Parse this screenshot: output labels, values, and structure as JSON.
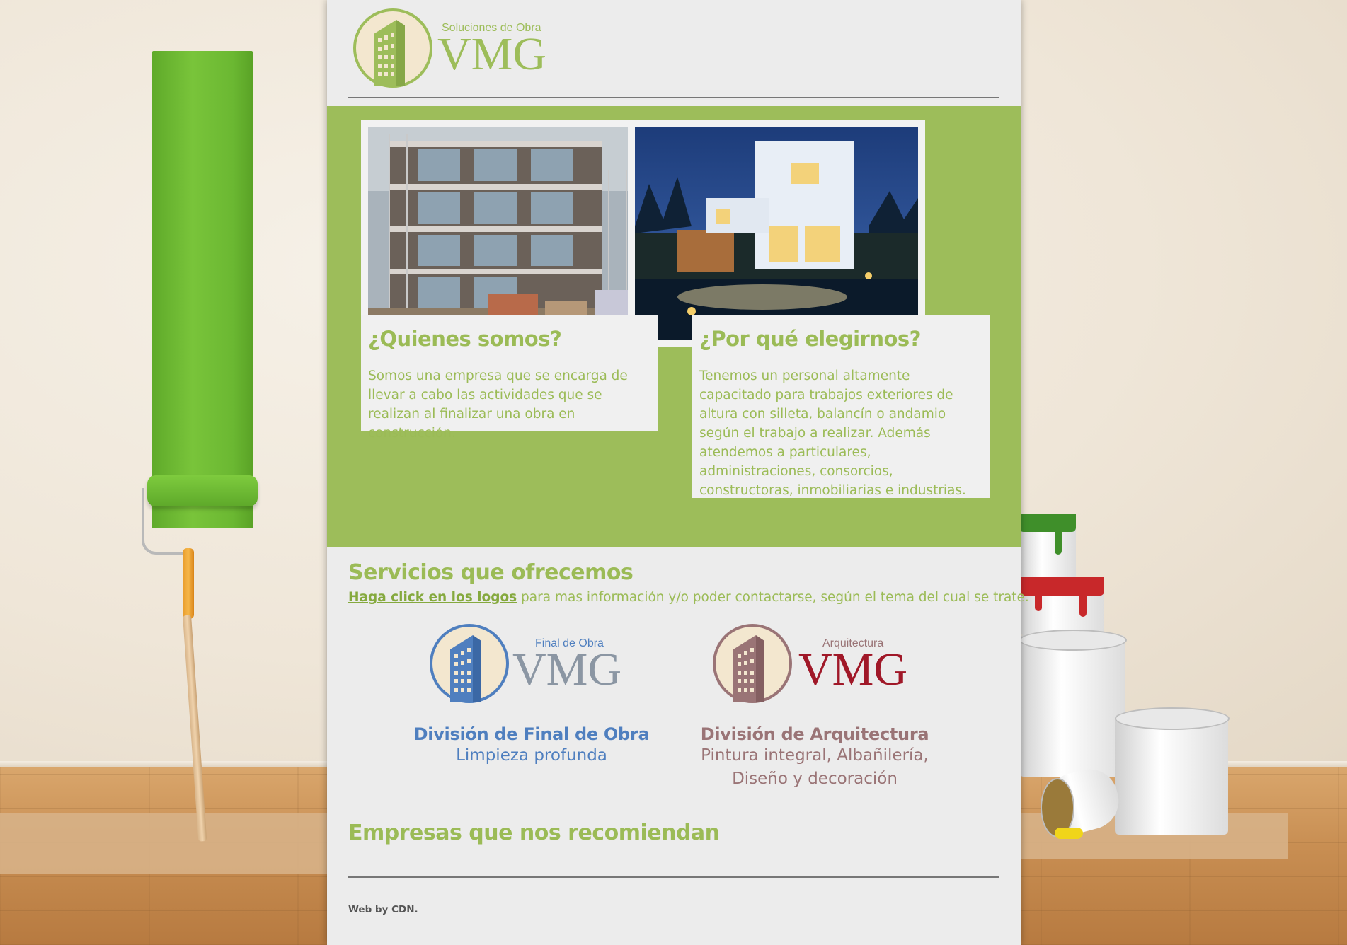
{
  "colors": {
    "brand_green": "#9dbd5a",
    "final_obra_blue": "#4f7fbf",
    "arquitectura_mauve": "#9a7476",
    "arquitectura_red": "#a01828",
    "page_bg": "#ececec"
  },
  "header": {
    "logo": {
      "tagline": "Soluciones de Obra",
      "wordmark": "VMG",
      "icon": "building-icon"
    }
  },
  "features": [
    {
      "image": "construction-building-photo",
      "title": "¿Quienes somos?",
      "body": "Somos una empresa que se encarga de llevar a cabo las actividades que se realizan al finalizar una obra en construcción."
    },
    {
      "image": "modern-house-night-photo",
      "title": "¿Por qué elegirnos?",
      "body": "Tenemos un personal altamente capacitado para trabajos exteriores de altura con silleta, balancín o andamio según el trabajo a realizar. Además atendemos a particulares, administraciones, consorcios, constructoras, inmobiliarias e industrias."
    }
  ],
  "services": {
    "title": "Servicios que ofrecemos",
    "intro_link": "Haga click en los logos",
    "intro_rest": " para mas información y/o poder contactarse, según el tema del cual se trate.",
    "divisions": [
      {
        "logo_tagline": "Final de Obra",
        "logo_wordmark": "VMG",
        "title": "División de Final de Obra",
        "subtitle": "Limpieza profunda"
      },
      {
        "logo_tagline": "Arquitectura",
        "logo_wordmark": "VMG",
        "title": "División de Arquitectura",
        "subtitle": "Pintura integral, Albañilería, Diseño y decoración"
      }
    ]
  },
  "recommend": {
    "title": "Empresas que nos recomiendan"
  },
  "footer": {
    "credit": "Web by CDN."
  }
}
